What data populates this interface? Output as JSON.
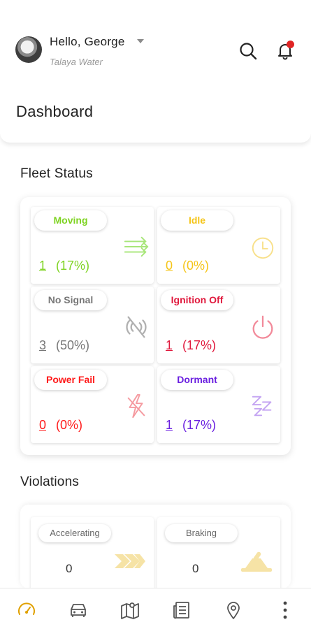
{
  "header": {
    "greeting": "Hello, George",
    "company": "Talaya Water",
    "page_title": "Dashboard",
    "notification_dot_color": "#e02424"
  },
  "fleet": {
    "title": "Fleet Status",
    "tiles": [
      {
        "label": "Moving",
        "count": "1",
        "percent": "(17%)",
        "color": "#7ed321",
        "icon": "moving-arrows-icon"
      },
      {
        "label": "Idle",
        "count": "0",
        "percent": "(0%)",
        "color": "#f5c518",
        "icon": "clock-icon"
      },
      {
        "label": "No Signal",
        "count": "3",
        "percent": "(50%)",
        "color": "#777777",
        "icon": "no-signal-icon"
      },
      {
        "label": "Ignition Off",
        "count": "1",
        "percent": "(17%)",
        "color": "#e0183c",
        "icon": "power-icon"
      },
      {
        "label": "Power Fail",
        "count": "0",
        "percent": "(0%)",
        "color": "#ff1a1a",
        "icon": "power-fail-icon"
      },
      {
        "label": "Dormant",
        "count": "1",
        "percent": "(17%)",
        "color": "#6a1fe0",
        "icon": "sleep-icon"
      }
    ]
  },
  "violations": {
    "title": "Violations",
    "tiles": [
      {
        "label": "Accelerating",
        "count": "0",
        "icon": "accelerating-icon"
      },
      {
        "label": "Braking",
        "count": "0",
        "icon": "braking-icon"
      }
    ]
  },
  "nav": {
    "active_color": "#e0a000",
    "items": [
      "speedometer-icon",
      "car-icon",
      "map-icon",
      "report-icon",
      "location-pin-icon",
      "more-icon"
    ]
  }
}
